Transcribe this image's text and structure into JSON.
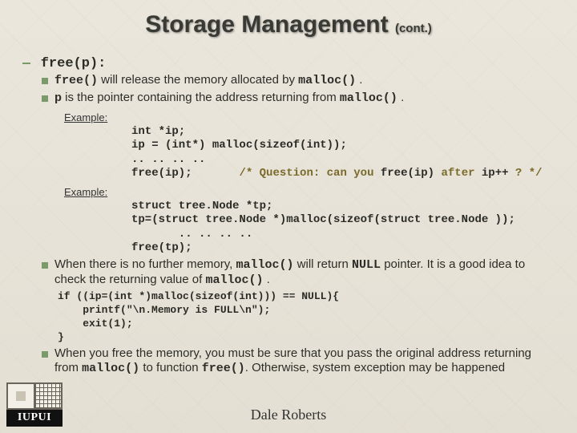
{
  "title_main": "Storage Management",
  "title_cont": "(cont.)",
  "free_heading": "free(p):",
  "bullets": {
    "b1_pre": "free()",
    "b1_mid": " will release the memory allocated by ",
    "b1_code2": "malloc()",
    "b1_end": " .",
    "b2_pre": "p",
    "b2_mid": " is the pointer containing the address returning from ",
    "b2_code2": "malloc()",
    "b2_end": " ."
  },
  "example_label": "Example:",
  "code1_l1": "int *ip;",
  "code1_l2": "ip = (int*) malloc(sizeof(int));",
  "code1_l3": ".. .. .. ..",
  "code1_l4a": "free(ip);",
  "code1_l4b": "/* Question: can you ",
  "code1_l4c": "free(ip)",
  "code1_l4d": " after ",
  "code1_l4e": "ip++",
  "code1_l4f": " ? */",
  "code2_l1": "struct tree.Node *tp;",
  "code2_l2": "tp=(struct tree.Node *)malloc(sizeof(struct tree.Node ));",
  "code2_l3": "       .. .. .. ..",
  "code2_l4": "free(tp);",
  "bullet3_a": "When there is no further memory, ",
  "bullet3_b": "malloc()",
  "bullet3_c": " will return ",
  "bullet3_d": "NULL",
  "bullet3_e": " pointer. It is a good idea to check the returning value of ",
  "bullet3_f": "malloc()",
  "bullet3_g": " .",
  "code3": "if ((ip=(int *)malloc(sizeof(int))) == NULL){\n    printf(\"\\n.Memory is FULL\\n\");\n    exit(1);\n}",
  "bullet4_a": "When you free the memory, you must be sure that you pass the original address returning from ",
  "bullet4_b": "malloc()",
  "bullet4_c": " to function ",
  "bullet4_d": "free()",
  "bullet4_e": ".  Otherwise, system exception may be happened",
  "footer": "Dale Roberts",
  "logo_text": "IUPUI"
}
